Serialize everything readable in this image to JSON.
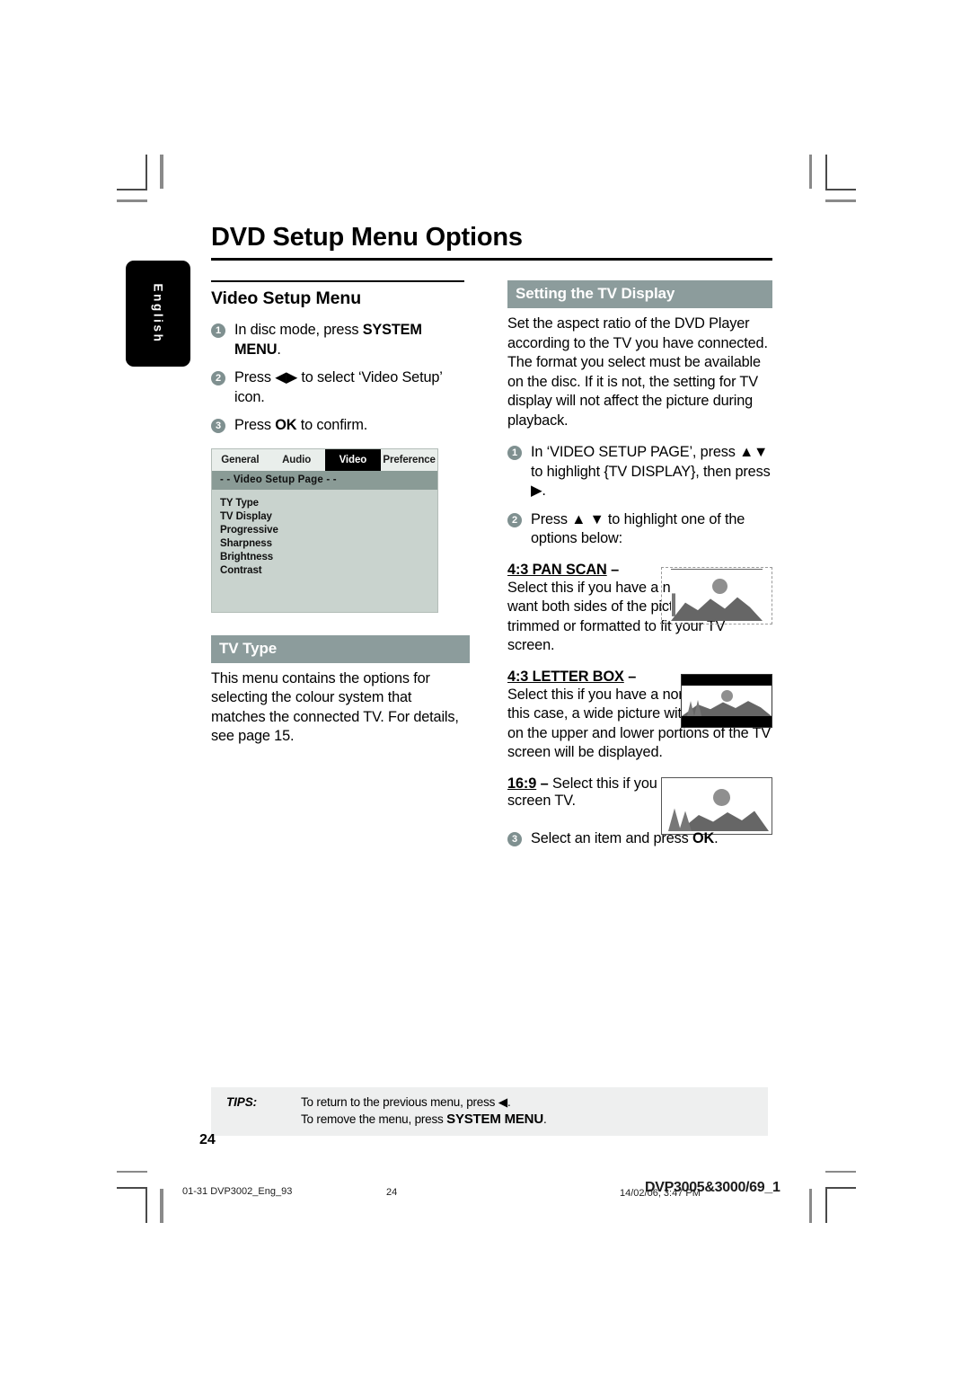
{
  "document": {
    "title": "DVD Setup Menu Options",
    "language_tab": "English",
    "page_number": "24"
  },
  "left_column": {
    "section_heading": "Video Setup Menu",
    "steps": [
      {
        "num": "1",
        "html_key": "step1"
      },
      {
        "num": "2",
        "html_key": "step2"
      },
      {
        "num": "3",
        "html_key": "step3"
      }
    ],
    "step1_pre": "In disc mode, press ",
    "step1_bold": "SYSTEM MENU",
    "step1_post": ".",
    "step2_pre": "Press ",
    "step2_arrows": "◀▶",
    "step2_post": " to select ‘Video Setup’ icon.",
    "step3_pre": "Press ",
    "step3_bold": "OK",
    "step3_post": " to confirm.",
    "dvd_menu": {
      "tabs": [
        "General",
        "Audio",
        "Video",
        "Preference"
      ],
      "active_tab": "Video",
      "page_bar": "- -  Video Setup Page  - -",
      "items": [
        "TY Type",
        "TV Display",
        "Progressive",
        "Sharpness",
        "Brightness",
        "Contrast"
      ]
    },
    "tv_type": {
      "heading": "TV Type",
      "body": "This menu contains the options for selecting the colour system that matches the connected TV.  For details, see page 15."
    }
  },
  "right_column": {
    "heading": "Setting the TV Display",
    "intro": "Set the aspect ratio of the DVD Player according to the TV you have connected. The format you select must be available on the disc.  If it is not, the setting for TV display will not affect the picture during playback.",
    "step1_pre": "In ‘VIDEO SETUP PAGE’, press ",
    "step1_arrows": "▲▼",
    "step1_mid": " to highlight {TV DISPLAY}, then press ",
    "step1_arrow2": "▶",
    "step1_post": ".",
    "step2_pre": "Press ",
    "step2_arrows": "▲ ▼",
    "step2_post": " to highlight one of the options below:",
    "step3_pre": "Select an item and press ",
    "step3_bold": "OK",
    "step3_post": ".",
    "options": [
      {
        "label": "4:3 PAN SCAN",
        "dash": " –",
        "text": "Select this if you have a normal TV and want both sides of the picture to be trimmed or formatted to fit your TV screen.",
        "illustration": "pan-scan-illustration"
      },
      {
        "label": "4:3 LETTER BOX",
        "dash": " –",
        "text": "Select this if you have a normal TV. In this case, a wide picture with black bands on the upper and lower portions of the TV screen will be displayed.",
        "illustration": "letter-box-illustration"
      },
      {
        "label": "16:9",
        "dash": " – ",
        "text": "Select this if you have a wide-screen TV.",
        "illustration": "widescreen-illustration"
      }
    ]
  },
  "tips": {
    "label": "TIPS:",
    "line1_pre": "To return to the previous menu, press ",
    "line1_arrow": "◀",
    "line1_post": ".",
    "line2_pre": "To remove the menu, press ",
    "line2_bold": "SYSTEM MENU",
    "line2_post": "."
  },
  "printer_footer": {
    "file": "01-31 DVP3002_Eng_93",
    "page": "24",
    "date": "14/02/06, 3:47 PM",
    "job": "DVP3005&3000/69_1"
  },
  "colors": {
    "bar_heading_bg": "#8c9c9c",
    "step_bullet": "#7f9090",
    "menu_bg": "#c9d3ce",
    "menu_pagebar": "#8a9b96",
    "tips_bg": "#eeefef"
  }
}
